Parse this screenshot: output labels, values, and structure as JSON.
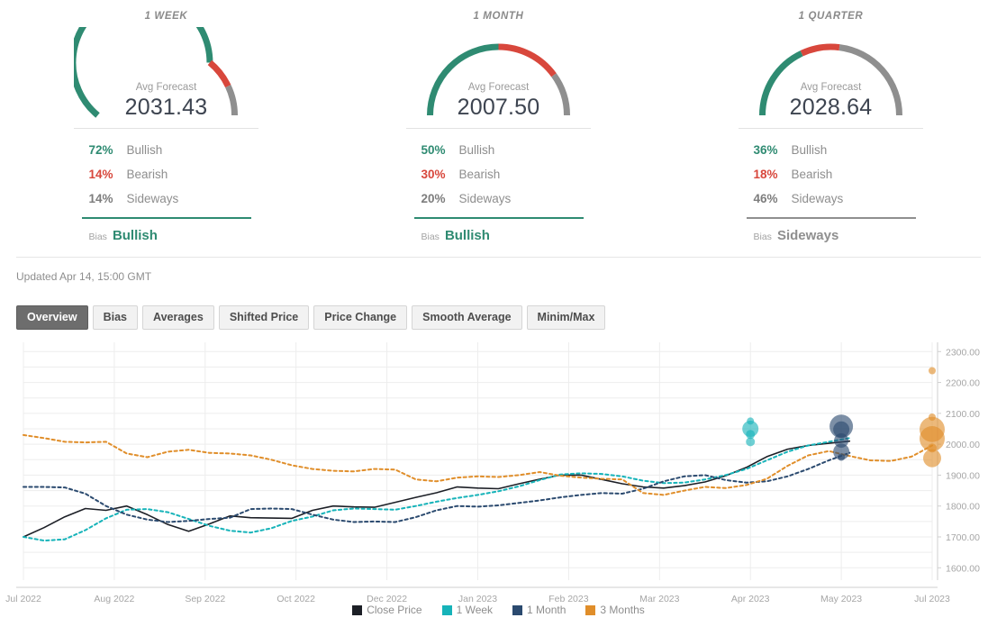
{
  "colors": {
    "bullish": "#2f8b72",
    "bearish": "#d8473c",
    "sideways": "#8f8f8f",
    "close_price": "#1c1f26",
    "week": "#16b3b9",
    "month": "#2b4a6f",
    "months3": "#e08e2a",
    "grid": "#ededed",
    "text_muted": "#8e8e8e"
  },
  "panels": [
    {
      "title": "1 WEEK",
      "gauge": {
        "sub_label": "Avg Forecast",
        "value": "2031.43",
        "segments": [
          {
            "name": "bullish",
            "pct": 72
          },
          {
            "name": "bearish",
            "pct": 14
          },
          {
            "name": "sideways",
            "pct": 14
          }
        ]
      },
      "stats": [
        {
          "pct": "72%",
          "label": "Bullish",
          "kind": "bullish"
        },
        {
          "pct": "14%",
          "label": "Bearish",
          "kind": "bearish"
        },
        {
          "pct": "14%",
          "label": "Sideways",
          "kind": "sideways"
        }
      ],
      "bias_key": "Bias",
      "bias_value": "Bullish",
      "bias_kind": "bullish"
    },
    {
      "title": "1 MONTH",
      "gauge": {
        "sub_label": "Avg Forecast",
        "value": "2007.50",
        "segments": [
          {
            "name": "bullish",
            "pct": 50
          },
          {
            "name": "bearish",
            "pct": 30
          },
          {
            "name": "sideways",
            "pct": 20
          }
        ]
      },
      "stats": [
        {
          "pct": "50%",
          "label": "Bullish",
          "kind": "bullish"
        },
        {
          "pct": "30%",
          "label": "Bearish",
          "kind": "bearish"
        },
        {
          "pct": "20%",
          "label": "Sideways",
          "kind": "sideways"
        }
      ],
      "bias_key": "Bias",
      "bias_value": "Bullish",
      "bias_kind": "bullish"
    },
    {
      "title": "1 QUARTER",
      "gauge": {
        "sub_label": "Avg Forecast",
        "value": "2028.64",
        "segments": [
          {
            "name": "bullish",
            "pct": 36
          },
          {
            "name": "bearish",
            "pct": 18
          },
          {
            "name": "sideways",
            "pct": 46
          }
        ]
      },
      "stats": [
        {
          "pct": "36%",
          "label": "Bullish",
          "kind": "bullish"
        },
        {
          "pct": "18%",
          "label": "Bearish",
          "kind": "bearish"
        },
        {
          "pct": "46%",
          "label": "Sideways",
          "kind": "sideways"
        }
      ],
      "bias_key": "Bias",
      "bias_value": "Sideways",
      "bias_kind": "sideways"
    }
  ],
  "updated": "Updated Apr 14, 15:00 GMT",
  "tabs": [
    {
      "label": "Overview",
      "active": true
    },
    {
      "label": "Bias",
      "active": false
    },
    {
      "label": "Averages",
      "active": false
    },
    {
      "label": "Shifted Price",
      "active": false
    },
    {
      "label": "Price Change",
      "active": false
    },
    {
      "label": "Smooth Average",
      "active": false
    },
    {
      "label": "Minim/Max",
      "active": false
    }
  ],
  "chart_data": {
    "type": "line",
    "title": "",
    "xlabel": "",
    "ylabel": "",
    "ylim": [
      1560,
      2330
    ],
    "yticks": [
      "1600.00",
      "1700.00",
      "1800.00",
      "1900.00",
      "2000.00",
      "2100.00",
      "2200.00",
      "2300.00"
    ],
    "ytick_values": [
      1600,
      1700,
      1800,
      1900,
      2000,
      2100,
      2200,
      2300
    ],
    "xticks": [
      "Jul 2022",
      "Aug 2022",
      "Sep 2022",
      "Oct 2022",
      "Dec 2022",
      "Jan 2023",
      "Feb 2023",
      "Mar 2023",
      "Apr 2023",
      "May 2023",
      "Jul 2023"
    ],
    "xtick_positions": [
      0,
      4.4,
      8.8,
      13.2,
      17.6,
      22.0,
      26.4,
      30.8,
      35.2,
      39.6,
      44.0
    ],
    "grid": true,
    "legend_position": "bottom",
    "legend": [
      "Close Price",
      "1 Week",
      "1 Month",
      "3 Months"
    ],
    "series": [
      {
        "name": "Close Price",
        "color": "#1c1f26",
        "style": "solid",
        "values": [
          1700,
          1730,
          1765,
          1792,
          1786,
          1800,
          1772,
          1740,
          1718,
          1742,
          1768,
          1762,
          1761,
          1760,
          1786,
          1800,
          1797,
          1796,
          1812,
          1828,
          1843,
          1862,
          1858,
          1856,
          1872,
          1887,
          1900,
          1900,
          1886,
          1872,
          1862,
          1858,
          1866,
          1878,
          1898,
          1925,
          1960,
          1984,
          1996,
          2003,
          2010,
          null,
          null,
          null,
          null
        ]
      },
      {
        "name": "1 Week",
        "color": "#16b3b9",
        "style": "dashed",
        "values": [
          1700,
          1688,
          1692,
          1722,
          1760,
          1788,
          1790,
          1780,
          1758,
          1736,
          1720,
          1714,
          1728,
          1752,
          1766,
          1786,
          1792,
          1790,
          1788,
          1800,
          1814,
          1826,
          1836,
          1848,
          1864,
          1884,
          1902,
          1906,
          1904,
          1896,
          1882,
          1874,
          1876,
          1886,
          1900,
          1920,
          1948,
          1976,
          1996,
          2008,
          2020,
          null,
          null,
          null,
          null
        ]
      },
      {
        "name": "1 Month",
        "color": "#2b4a6f",
        "style": "dashed",
        "values": [
          1862,
          1862,
          1860,
          1840,
          1800,
          1772,
          1756,
          1748,
          1752,
          1758,
          1762,
          1790,
          1792,
          1790,
          1772,
          1756,
          1748,
          1750,
          1748,
          1764,
          1786,
          1800,
          1798,
          1802,
          1810,
          1818,
          1828,
          1836,
          1842,
          1840,
          1856,
          1880,
          1896,
          1900,
          1884,
          1876,
          1880,
          1896,
          1920,
          1948,
          1972,
          null,
          null,
          null,
          null
        ]
      },
      {
        "name": "3 Months",
        "color": "#e08e2a",
        "style": "dashed",
        "values": [
          2030,
          2020,
          2008,
          2006,
          2008,
          1970,
          1958,
          1976,
          1982,
          1972,
          1970,
          1964,
          1950,
          1932,
          1920,
          1914,
          1912,
          1920,
          1918,
          1886,
          1880,
          1892,
          1896,
          1894,
          1900,
          1910,
          1898,
          1892,
          1888,
          1886,
          1842,
          1836,
          1850,
          1862,
          1858,
          1868,
          1888,
          1930,
          1964,
          1978,
          1962,
          1948,
          1946,
          1960,
          1996
        ]
      }
    ],
    "forecast_points": [
      {
        "series": "1 Week",
        "x": 35.2,
        "y": 2075,
        "size": 4
      },
      {
        "series": "1 Week",
        "x": 35.2,
        "y": 2050,
        "size": 9
      },
      {
        "series": "1 Week",
        "x": 35.2,
        "y": 2032,
        "size": 5
      },
      {
        "series": "1 Week",
        "x": 35.2,
        "y": 2008,
        "size": 5
      },
      {
        "series": "1 Month",
        "x": 39.6,
        "y": 2058,
        "size": 13
      },
      {
        "series": "1 Month",
        "x": 39.6,
        "y": 2048,
        "size": 9
      },
      {
        "series": "1 Month",
        "x": 39.6,
        "y": 2012,
        "size": 8
      },
      {
        "series": "1 Month",
        "x": 39.6,
        "y": 1976,
        "size": 9
      },
      {
        "series": "1 Month",
        "x": 39.6,
        "y": 1958,
        "size": 4
      },
      {
        "series": "3 Months",
        "x": 44.0,
        "y": 2238,
        "size": 4
      },
      {
        "series": "3 Months",
        "x": 44.0,
        "y": 2088,
        "size": 4
      },
      {
        "series": "3 Months",
        "x": 44.0,
        "y": 2048,
        "size": 14
      },
      {
        "series": "3 Months",
        "x": 44.0,
        "y": 2018,
        "size": 14
      },
      {
        "series": "3 Months",
        "x": 44.0,
        "y": 1988,
        "size": 5
      },
      {
        "series": "3 Months",
        "x": 44.0,
        "y": 1955,
        "size": 10
      }
    ]
  }
}
